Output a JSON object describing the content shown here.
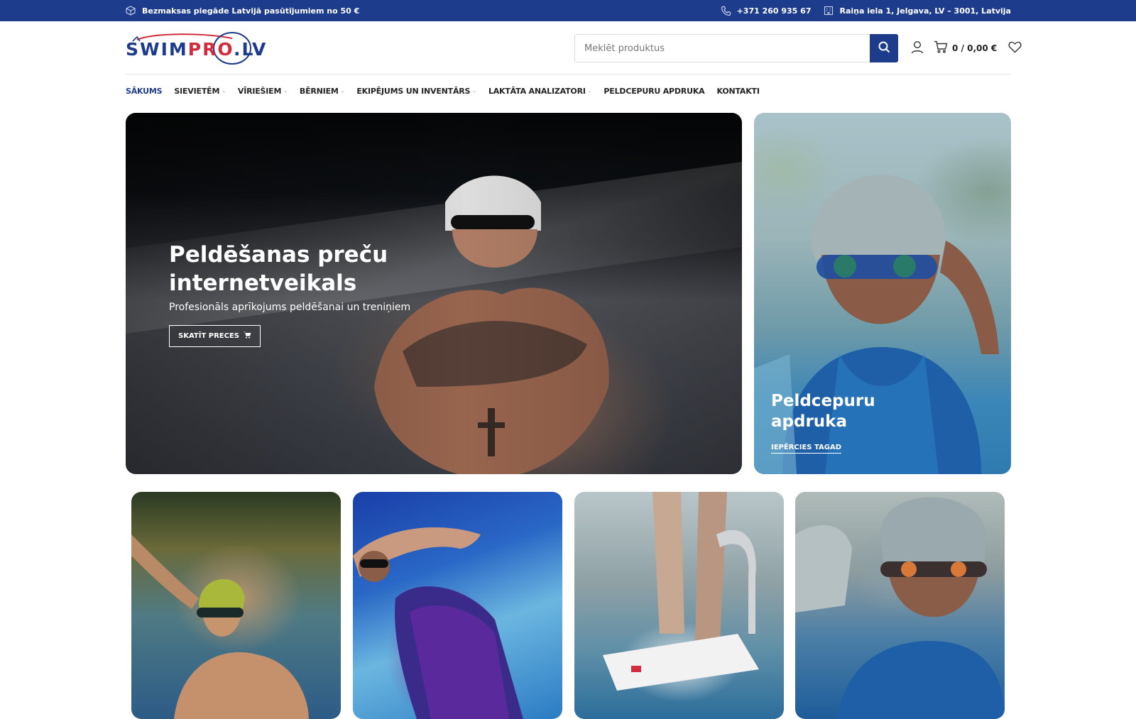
{
  "topbar": {
    "shipping_icon": "box-icon",
    "shipping_text": "Bezmaksas piegāde Latvijā pasūtījumiem no 50 €",
    "phone_icon": "phone-icon",
    "phone": "+371 260 935 67",
    "address_icon": "building-icon",
    "address": "Raiņa iela 1, Jelgava, LV – 3001, Latvija"
  },
  "logo": {
    "part1": "SWIM",
    "part2": "PRO",
    "part3": ".LV"
  },
  "search": {
    "placeholder": "Meklēt produktus",
    "button_icon": "search-icon"
  },
  "header": {
    "account_icon": "user-icon",
    "cart_icon": "cart-icon",
    "cart_text": "0 / 0,00 €",
    "wishlist_icon": "heart-icon"
  },
  "nav": {
    "items": [
      {
        "label": "Sākums",
        "active": true,
        "dropdown": false
      },
      {
        "label": "Sievietēm",
        "active": false,
        "dropdown": true
      },
      {
        "label": "Vīriešiem",
        "active": false,
        "dropdown": true
      },
      {
        "label": "Bērniem",
        "active": false,
        "dropdown": true
      },
      {
        "label": "Ekipējums un inventārs",
        "active": false,
        "dropdown": true
      },
      {
        "label": "Laktāta analizatori",
        "active": false,
        "dropdown": true
      },
      {
        "label": "Peldcepuru apdruka",
        "active": false,
        "dropdown": false
      },
      {
        "label": "Kontakti",
        "active": false,
        "dropdown": false
      }
    ]
  },
  "hero": {
    "title": "Peldēšanas preču internetveikals",
    "subtitle": "Profesionāls aprīkojums peldēšanai un treniņiem",
    "button_label": "SKATĪT PRECES",
    "button_icon": "cart-icon"
  },
  "promo": {
    "title": "Peldcepuru apdruka",
    "link_label": "IEPĒRCIES TAGAD"
  },
  "colors": {
    "brand_blue": "#1e3c8c",
    "brand_red": "#d12d3c"
  }
}
